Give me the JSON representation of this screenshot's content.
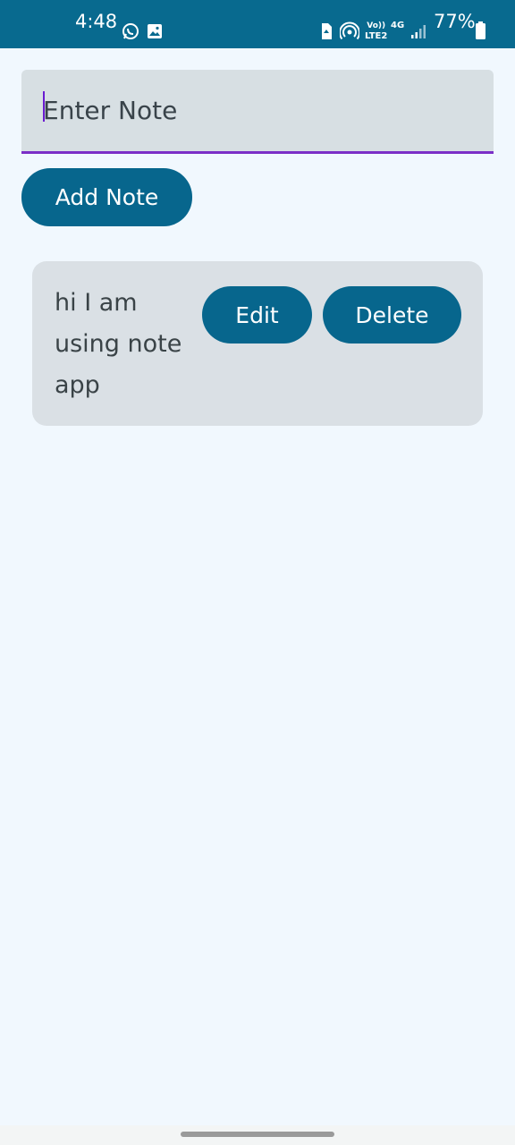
{
  "status_bar": {
    "time": "4:48",
    "battery_percent": "77%",
    "volte_top": "Vo))",
    "volte_bottom": "LTE2",
    "network_type": "4G",
    "icons": [
      "whatsapp-icon",
      "gallery-icon",
      "sim-icon",
      "hotspot-icon",
      "signal-icon",
      "battery-icon"
    ],
    "background_color": "#086a8f"
  },
  "note_input": {
    "placeholder": "Enter Note",
    "value": ""
  },
  "add_button": {
    "label": "Add Note"
  },
  "notes": [
    {
      "text": "hi I am using note app",
      "edit_label": "Edit",
      "delete_label": "Delete"
    }
  ],
  "colors": {
    "accent": "#07668d",
    "input_underline": "#7b2fc7",
    "background": "#f1f8fe",
    "card": "#dae0e5"
  }
}
